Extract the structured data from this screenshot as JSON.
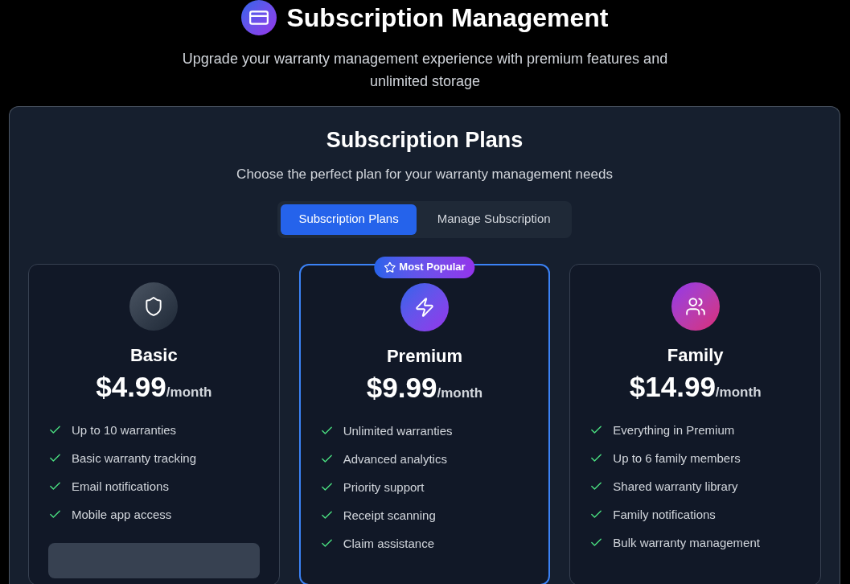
{
  "header": {
    "title": "Subscription Management",
    "subtitle": "Upgrade your warranty management experience with premium features and unlimited storage"
  },
  "panel": {
    "title": "Subscription Plans",
    "description": "Choose the perfect plan for your warranty management needs",
    "tabs": [
      {
        "label": "Subscription Plans",
        "selected": true
      },
      {
        "label": "Manage Subscription",
        "selected": false
      }
    ]
  },
  "plans": [
    {
      "kind": "basic",
      "name": "Basic",
      "price": "$4.99",
      "period": "/month",
      "featured": false,
      "features": [
        "Up to 10 warranties",
        "Basic warranty tracking",
        "Email notifications",
        "Mobile app access"
      ],
      "has_button": true
    },
    {
      "kind": "premium",
      "name": "Premium",
      "price": "$9.99",
      "period": "/month",
      "featured": true,
      "badge": "Most Popular",
      "features": [
        "Unlimited warranties",
        "Advanced analytics",
        "Priority support",
        "Receipt scanning",
        "Claim assistance"
      ],
      "has_button": false
    },
    {
      "kind": "family",
      "name": "Family",
      "price": "$14.99",
      "period": "/month",
      "featured": false,
      "features": [
        "Everything in Premium",
        "Up to 6 family members",
        "Shared warranty library",
        "Family notifications",
        "Bulk warranty management"
      ],
      "has_button": false
    }
  ]
}
